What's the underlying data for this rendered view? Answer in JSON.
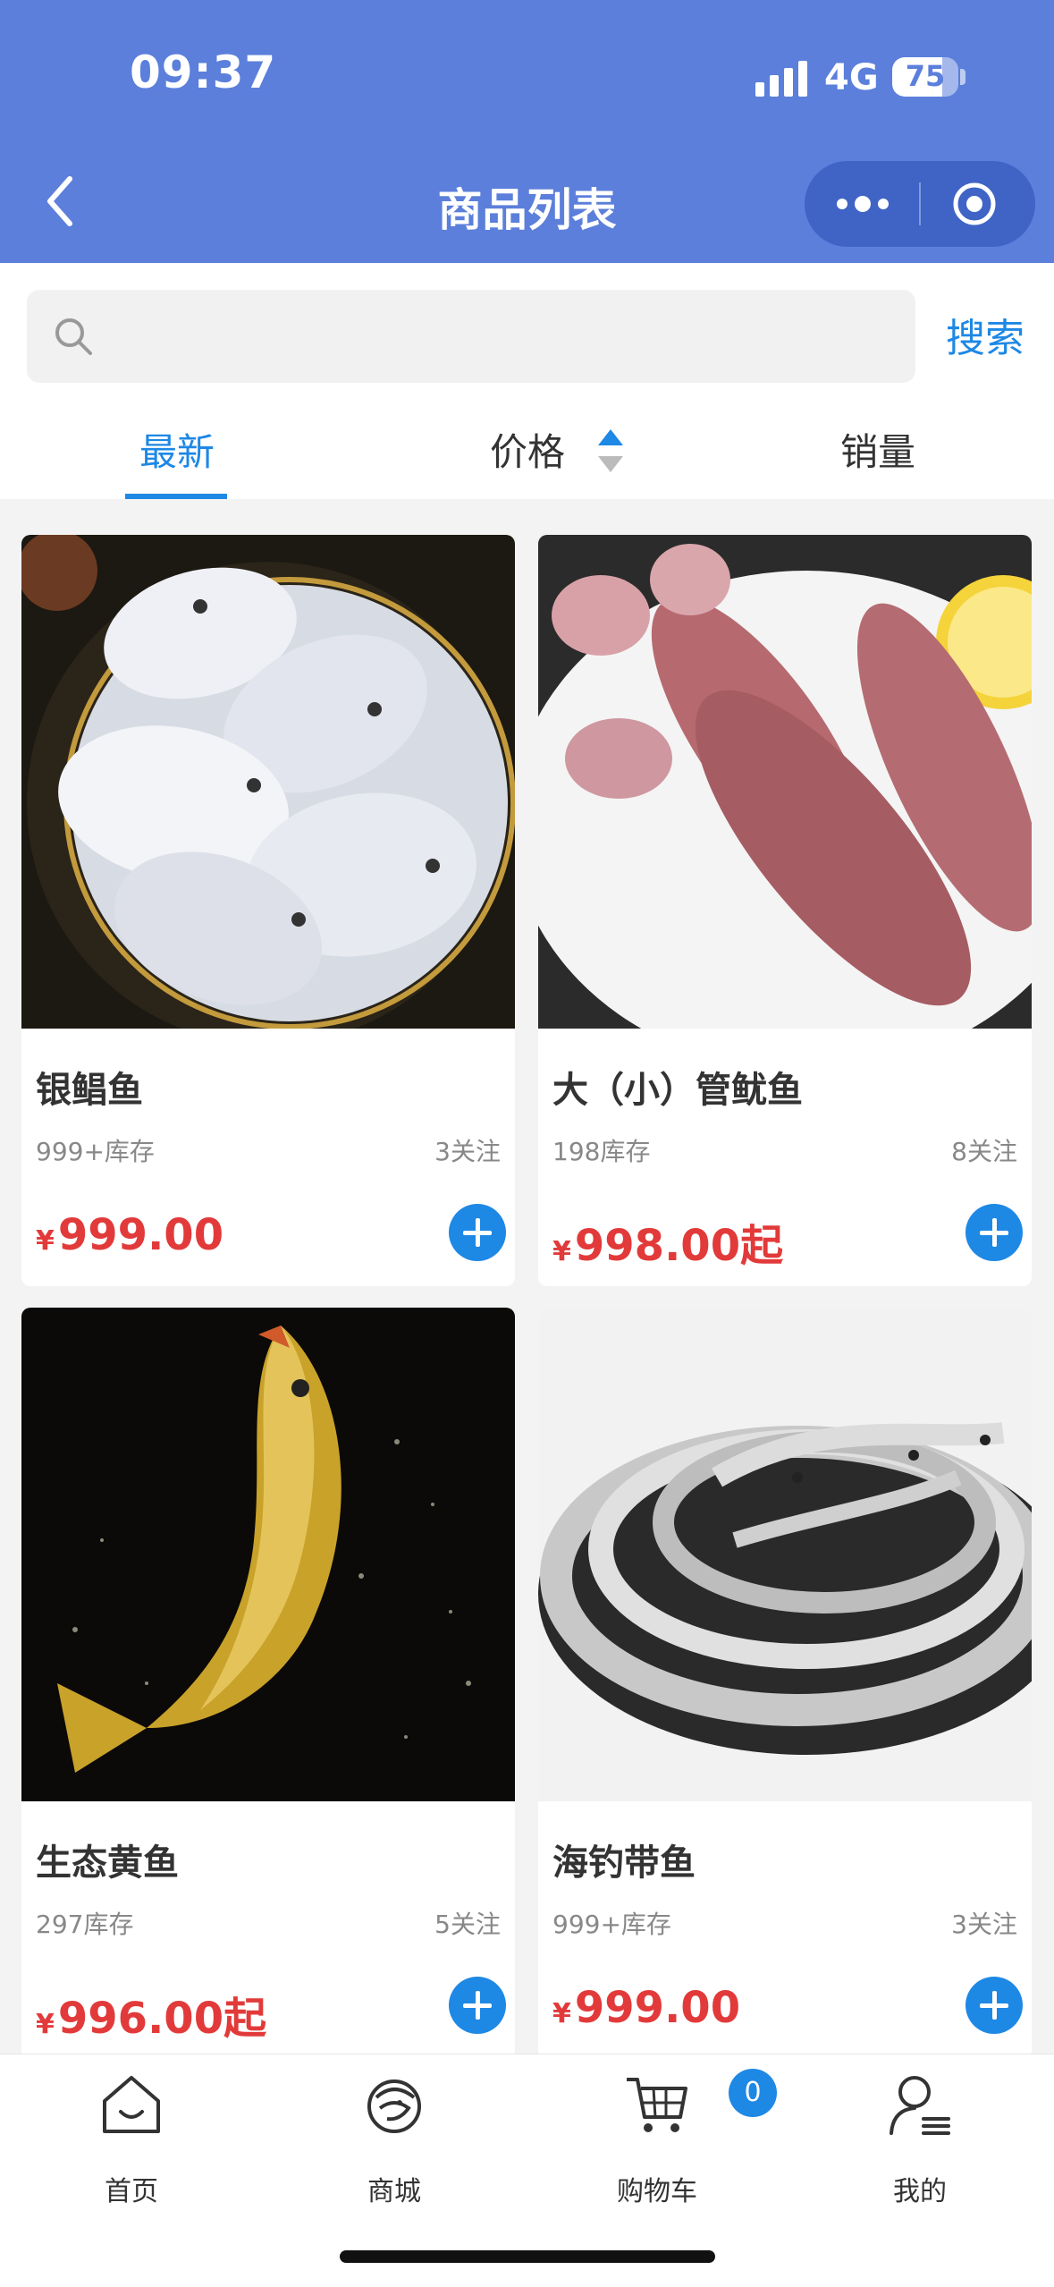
{
  "status": {
    "time": "09:37",
    "network": "4G",
    "battery": "75"
  },
  "nav": {
    "title": "商品列表"
  },
  "search": {
    "placeholder": "",
    "button_label": "搜索"
  },
  "tabs": [
    {
      "label": "最新",
      "active": true
    },
    {
      "label": "价格",
      "active": false
    },
    {
      "label": "销量",
      "active": false
    }
  ],
  "products": [
    {
      "name": "银鲳鱼",
      "stock": "999+库存",
      "followers": "3关注",
      "currency": "¥",
      "price": "999.00"
    },
    {
      "name": "大（小）管鱿鱼",
      "stock": "198库存",
      "followers": "8关注",
      "currency": "¥",
      "price": "998.00起"
    },
    {
      "name": "生态黄鱼",
      "stock": "297库存",
      "followers": "5关注",
      "currency": "¥",
      "price": "996.00起"
    },
    {
      "name": "海钓带鱼",
      "stock": "999+库存",
      "followers": "3关注",
      "currency": "¥",
      "price": "999.00"
    }
  ],
  "tabbar": [
    {
      "label": "首页",
      "icon": "home-icon"
    },
    {
      "label": "商城",
      "icon": "shrimp-icon"
    },
    {
      "label": "购物车",
      "icon": "cart-icon",
      "badge": "0"
    },
    {
      "label": "我的",
      "icon": "user-icon"
    }
  ],
  "colors": {
    "header": "#5b7fdb",
    "accent": "#1e88e5",
    "price": "#e23a3a"
  }
}
